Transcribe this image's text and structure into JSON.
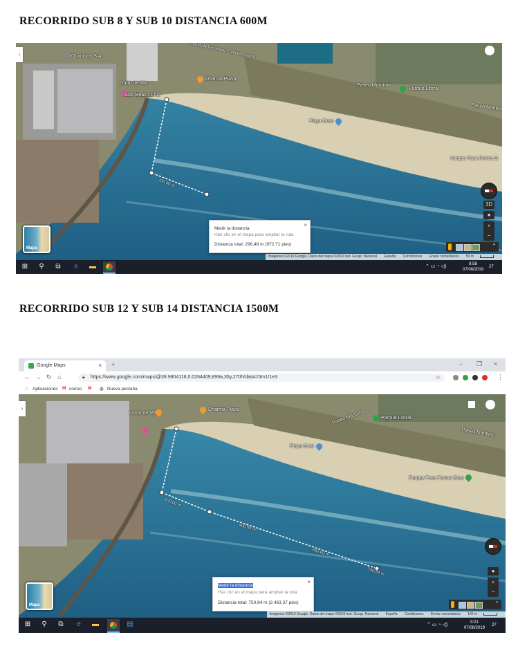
{
  "page": {
    "title_1": "RECORRIDO SUB 8 Y SUB 10  DISTANCIA 600M",
    "title_2": "RECORRIDO SUB 12 Y SUB 14 DISTANCIA 1500M"
  },
  "colors": {
    "sea": "#2a7aa0",
    "sea_dark": "#1f5f84",
    "beach": "#d9cfb3",
    "taskbar": "#1b1f2a",
    "route": "#ffffff",
    "pin_orange": "#f29a2e",
    "pin_pink": "#e0509a",
    "pin_green": "#2fa34a",
    "pin_blue": "#4a8fd0"
  },
  "shot1": {
    "labels": {
      "quimigra": "Quimigra, S.A.",
      "lorito": "Lorito de Mar",
      "nudo": "Nudo Beach Club",
      "dharma": "Dharma Playa",
      "playa_grao": "Playa Grao",
      "parque_litoral": "Parque Litoral",
      "parque_perros": "Parque Para Perros G",
      "paseo_maritimo_1": "Paseo Marítimo",
      "paseo_maritimo_2": "Paseo Marítimo",
      "calle": "Carrer de l'Enginyer Francesc Aragó",
      "segment": "200,00 m"
    },
    "thumb": "Mapa",
    "controls": {
      "view3d": "3D",
      "plus": "+",
      "minus": "−"
    },
    "measure": {
      "title": "Medir la distancia",
      "hint": "Haz clic en el mapa para ampliar la ruta",
      "total": "Distancia total: 296,48 m (972,71 pies)",
      "close": "×"
    },
    "attribution": {
      "imagery": "Imágenes ©2019 Google, Datos del mapa ©2019 Inst. Geogr. Nacional",
      "country": "España",
      "terms": "Condiciones",
      "feedback": "Enviar comentarios",
      "scale": "50 m"
    },
    "tray": {
      "time": "8:58",
      "date": "07/08/2019",
      "notif": "27"
    }
  },
  "shot2": {
    "browser": {
      "tab_title": "Google Maps",
      "url": "https://www.google.com/maps/@39.9804116,0.0264409,899a,35y,270h/data=!3m1!1e3",
      "bookmarks": [
        "Aplicaciones",
        "correo",
        "Nueva pestaña"
      ]
    },
    "labels": {
      "lorito": "Lorito de Mar",
      "dharma": "Dharma Playa",
      "playa_grao": "Playa Grao",
      "parque_litoral": "Parque Litoral",
      "paseo_maritimo_1": "Paseo Marítimo",
      "paseo_maritimo_2": "Paseo Marítimo",
      "parque_perros": "Parque Para Perros Grao",
      "seg1": "200,00 m",
      "seg2": "400,00 m",
      "seg3": "600,00 m",
      "seg4": "750,84 m"
    },
    "thumb": "Mapa",
    "controls": {
      "plus": "+",
      "minus": "−"
    },
    "measure": {
      "title": "Medir la distancia",
      "hint": "Haz clic en el mapa para ampliar la ruta",
      "total": "Distancia total: 750,84 m (2.463,37 pies)",
      "close": "×"
    },
    "attribution": {
      "imagery": "Imágenes ©2019 Google, Datos del mapa ©2019 Inst. Geogr. Nacional",
      "country": "España",
      "terms": "Condiciones",
      "feedback": "Enviar comentarios",
      "scale": "100 m"
    },
    "tray": {
      "time": "9:21",
      "date": "07/08/2019",
      "notif": "27"
    }
  }
}
